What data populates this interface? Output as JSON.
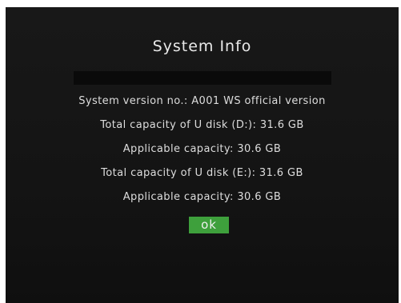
{
  "dialog": {
    "title": "System Info",
    "lines": [
      "System version no.: A001 WS official version",
      "Total capacity of U disk (D:): 31.6 GB",
      "Applicable capacity: 30.6 GB",
      "Total capacity of U disk (E:): 31.6 GB",
      "Applicable capacity: 30.6 GB"
    ],
    "ok_label": "ok"
  },
  "colors": {
    "background": "#141414",
    "text": "#dddddd",
    "ok_button": "#3ea03c"
  }
}
